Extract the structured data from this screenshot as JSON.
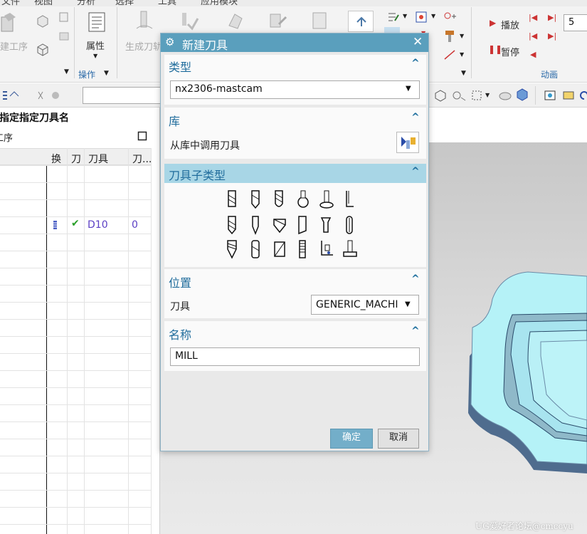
{
  "ribbon": {
    "menu": [
      "文件",
      "视图",
      "分析",
      "选择",
      "工具",
      "应用模块"
    ],
    "create_operation": "建工序",
    "properties": "属性",
    "generate_toolpath": "生成刀轨",
    "group_operations": "操作",
    "play": "播放",
    "pause": "暂停",
    "animation_group": "动画",
    "speed_value": "5"
  },
  "navigator": {
    "title": "指定指定刀具名",
    "subtitle": "工序",
    "columns": [
      "换",
      "刀",
      "刀具",
      "刀..."
    ],
    "row": {
      "tool": "D10",
      "number": "0"
    }
  },
  "dialog": {
    "title": "新建刀具",
    "type_section": "类型",
    "type_value": "nx2306-mastcam",
    "library_section": "库",
    "library_label": "从库中调用刀具",
    "subtype_section": "刀具子类型",
    "location_section": "位置",
    "tool_label": "刀具",
    "tool_value": "GENERIC_MACHI",
    "name_section": "名称",
    "name_value": "MILL",
    "ok": "确定",
    "cancel": "取消"
  },
  "watermark": "UG爱好者论坛@cmccyu",
  "colors": {
    "dialog_title": "#5a9fbd",
    "section_header": "#1f6c9c",
    "ok_button": "#73aec9",
    "part_fill": "#b5f2f7"
  }
}
